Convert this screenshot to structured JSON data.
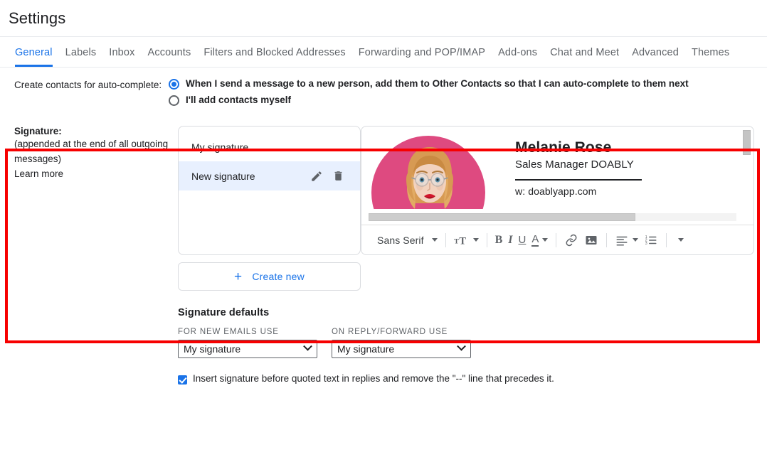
{
  "header": {
    "title": "Settings"
  },
  "tabs": [
    {
      "label": "General",
      "active": true
    },
    {
      "label": "Labels",
      "active": false
    },
    {
      "label": "Inbox",
      "active": false
    },
    {
      "label": "Accounts",
      "active": false
    },
    {
      "label": "Filters and Blocked Addresses",
      "active": false
    },
    {
      "label": "Forwarding and POP/IMAP",
      "active": false
    },
    {
      "label": "Add-ons",
      "active": false
    },
    {
      "label": "Chat and Meet",
      "active": false
    },
    {
      "label": "Advanced",
      "active": false
    },
    {
      "label": "Themes",
      "active": false
    }
  ],
  "autocomplete": {
    "label": "Create contacts for auto-complete:",
    "options": [
      {
        "text": "When I send a message to a new person, add them to Other Contacts so that I can auto-complete to them next",
        "selected": true
      },
      {
        "text": "I'll add contacts myself",
        "selected": false
      }
    ]
  },
  "signature": {
    "label": "Signature:",
    "description": "(appended at the end of all outgoing messages)",
    "learn_more": "Learn more",
    "items": [
      {
        "name": "My signature",
        "selected": false
      },
      {
        "name": "New signature",
        "selected": true
      }
    ],
    "edit_icon": "pencil-icon",
    "delete_icon": "trash-icon",
    "create_new": "Create new",
    "preview": {
      "name": "Melanie Rose",
      "role": "Sales Manager DOABLY",
      "website": "w: doablyapp.com",
      "avatar_bg": "#de4a80"
    },
    "toolbar": {
      "font": "Sans Serif",
      "size_icon": "text-size-icon",
      "bold": "B",
      "italic": "I",
      "underline": "U",
      "text_color": "A",
      "link_icon": "link-icon",
      "image_icon": "insert-image-icon",
      "align_icon": "align-left-icon",
      "list_icon": "numbered-list-icon",
      "more_icon": "more-options-icon"
    }
  },
  "defaults": {
    "title": "Signature defaults",
    "new_emails_caption": "FOR NEW EMAILS USE",
    "new_emails_value": "My signature",
    "reply_caption": "ON REPLY/FORWARD USE",
    "reply_value": "My signature",
    "insert_before_quoted": "Insert signature before quoted text in replies and remove the \"--\" line that precedes it.",
    "insert_before_quoted_checked": true
  },
  "colors": {
    "accent": "#1a73e8",
    "highlight_box": "#f70000",
    "text_primary": "#202124",
    "text_secondary": "#5f6368"
  }
}
